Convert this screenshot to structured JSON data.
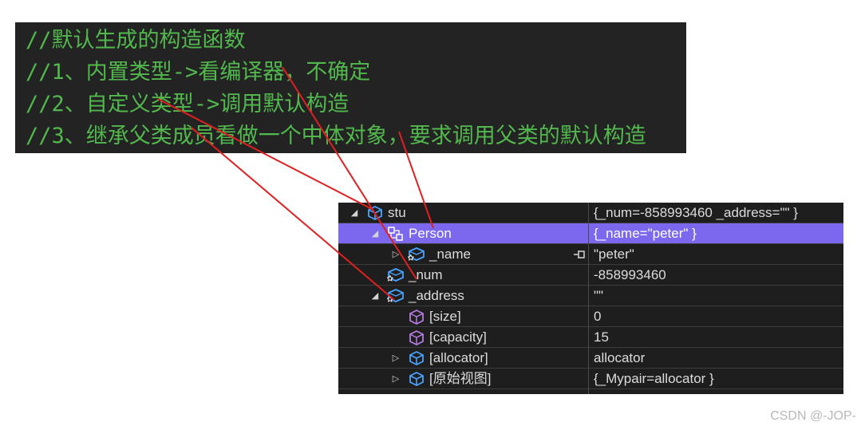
{
  "code_comments": [
    "//默认生成的构造函数",
    "//1、内置类型->看编译器，不确定",
    "//2、自定义类型->调用默认构造",
    "//3、继承父类成员看做一个中体对象，要求调用父类的默认构造"
  ],
  "watch_rows": [
    {
      "expander": "◢",
      "icon": "variable-icon",
      "name": "stu",
      "value": "{_num=-858993460 _address=\"\" }"
    },
    {
      "expander": "◢",
      "icon": "base-class-icon",
      "name": "Person",
      "value": "{_name=\"peter\" }"
    },
    {
      "expander": "▷",
      "icon": "field-icon",
      "name": "_name",
      "value": "\"peter\""
    },
    {
      "expander": "",
      "icon": "field-icon",
      "name": "_num",
      "value": "-858993460"
    },
    {
      "expander": "◢",
      "icon": "field-icon",
      "name": "_address",
      "value": "\"\""
    },
    {
      "expander": "",
      "icon": "cube-icon",
      "name": "[size]",
      "value": "0"
    },
    {
      "expander": "",
      "icon": "cube-icon",
      "name": "[capacity]",
      "value": "15"
    },
    {
      "expander": "▷",
      "icon": "field-icon",
      "name": "[allocator]",
      "value": "allocator"
    },
    {
      "expander": "▷",
      "icon": "field-icon",
      "name": "[原始视图]",
      "value": "{_Mypair=allocator }"
    }
  ],
  "colors": {
    "comment_green": "#52b84e",
    "selection": "#7b68ee",
    "arrow_red": "#e02020",
    "panel_bg": "#1e1e1e"
  },
  "watermark": "CSDN @-JOP-"
}
